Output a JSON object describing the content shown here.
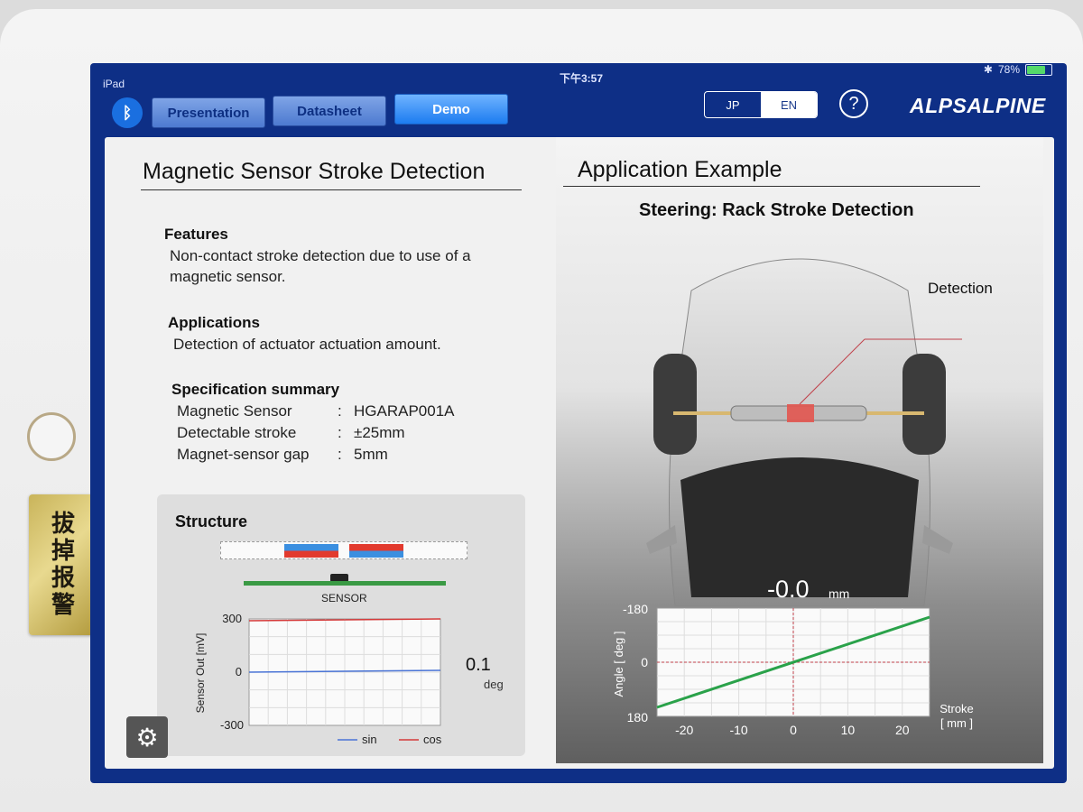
{
  "status_bar": {
    "device": "iPad",
    "time": "下午3:57",
    "battery": "78%",
    "battery_level": 0.78
  },
  "toolbar": {
    "tabs": [
      {
        "label": "Presentation",
        "active": false
      },
      {
        "label": "Datasheet",
        "active": false
      },
      {
        "label": "Demo",
        "active": true
      }
    ],
    "lang_jp": "JP",
    "lang_en": "EN",
    "help": "?",
    "brand": "ALPSALPINE"
  },
  "left": {
    "title": "Magnetic Sensor Stroke Detection",
    "features_head": "Features",
    "features_body_1": "Non-contact stroke detection due to use of a",
    "features_body_2": "magnetic sensor.",
    "applications_head": "Applications",
    "applications_body": "Detection of actuator actuation amount.",
    "spec_head": "Specification summary",
    "specs": [
      {
        "key": "Magnetic Sensor",
        "sep": ":",
        "value": "HGARAP001A"
      },
      {
        "key": "Detectable stroke",
        "sep": ":",
        "value": "±25mm"
      },
      {
        "key": "Magnet-sensor gap",
        "sep": ":",
        "value": "5mm"
      }
    ]
  },
  "structure": {
    "title": "Structure",
    "sensor_label": "SENSOR",
    "readout_value": "0.1",
    "readout_unit": "deg"
  },
  "right": {
    "title": "Application Example",
    "subtitle": "Steering: Rack Stroke Detection",
    "detection_label": "Detection",
    "stroke_value": "-0.0",
    "stroke_unit": "mm"
  },
  "colors": {
    "accent": "#1c7cf0",
    "sin": "#4a74d6",
    "cos": "#d43a3a",
    "line": "#2aa24a",
    "screen": "#0e2f86"
  },
  "chart_data": [
    {
      "type": "line",
      "ylabel": "Sensor Out [mV]",
      "ylim": [
        -300,
        300
      ],
      "yticks": [
        "300",
        "0",
        "-300"
      ],
      "grid": true,
      "legend": "bottom-right",
      "series": [
        {
          "name": "sin",
          "x": [
            0,
            1
          ],
          "values": [
            0,
            10
          ]
        },
        {
          "name": "cos",
          "x": [
            0,
            1
          ],
          "values": [
            290,
            300
          ]
        }
      ]
    },
    {
      "type": "line",
      "xlabel": "Stroke",
      "xlabel_unit": "[ mm ]",
      "ylabel": "Angle [ deg ]",
      "xlim": [
        -25,
        25
      ],
      "ylim": [
        -180,
        180
      ],
      "xticks": [
        "-20",
        "-10",
        "0",
        "10",
        "20"
      ],
      "yticks": [
        "-180",
        "0",
        "180"
      ],
      "grid": true,
      "series": [
        {
          "x": [
            -25,
            25
          ],
          "values": [
            150,
            -150
          ]
        }
      ]
    }
  ]
}
